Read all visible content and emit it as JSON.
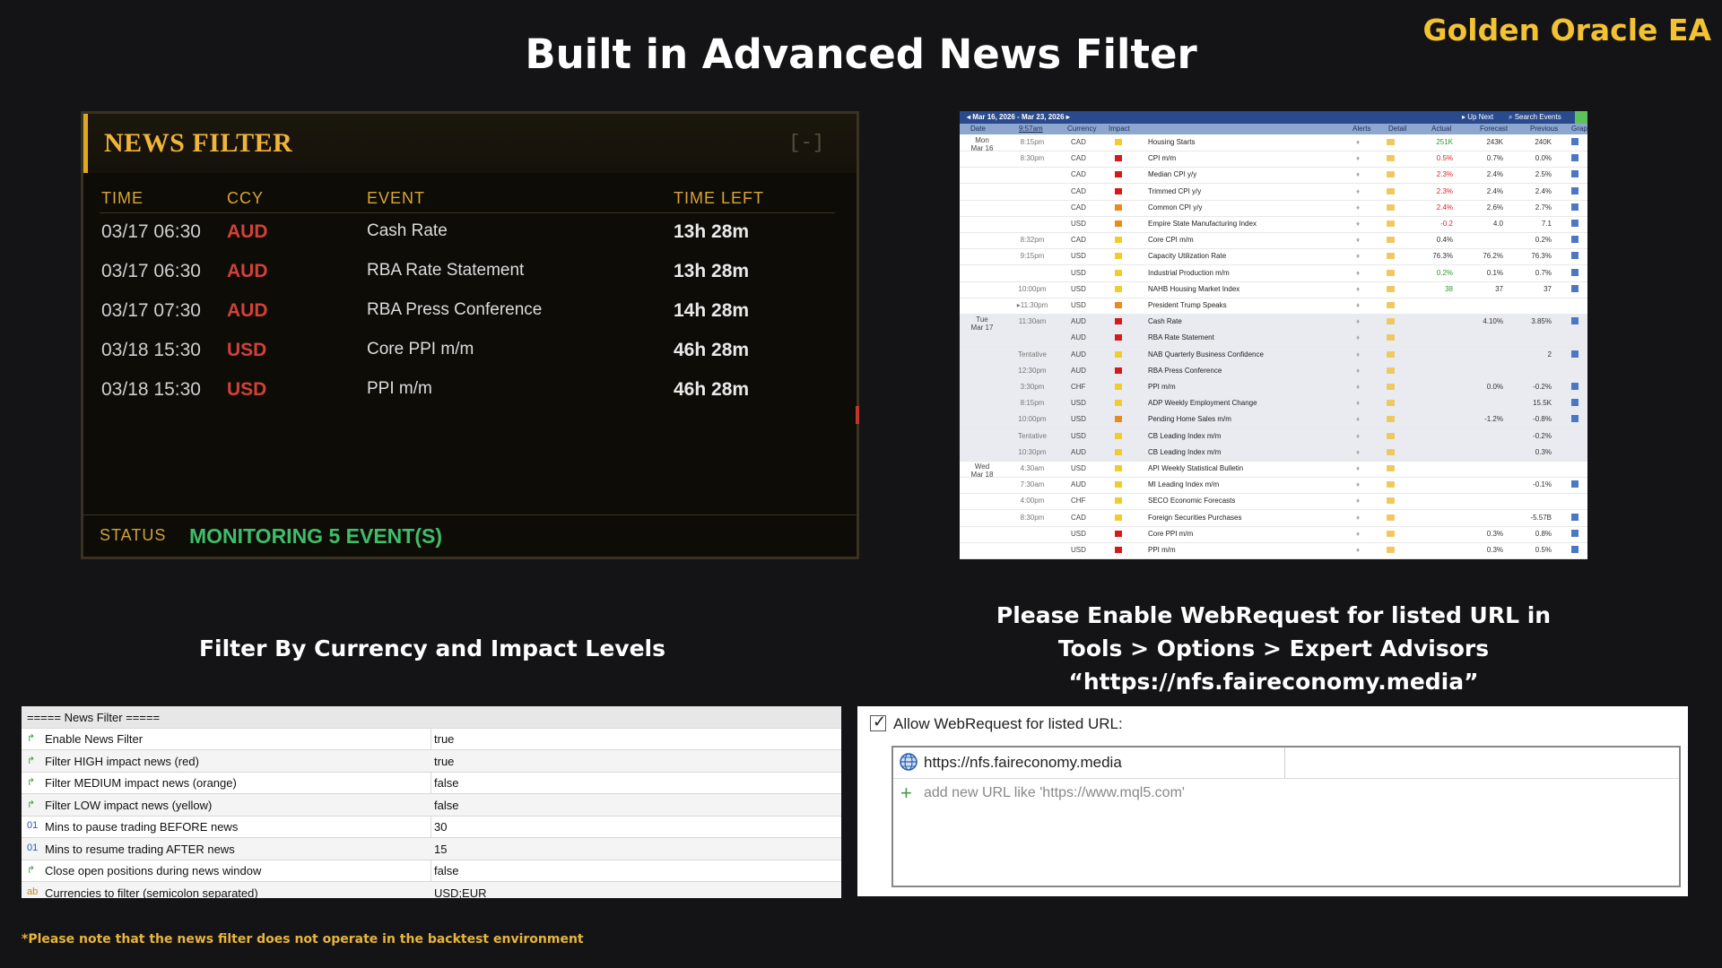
{
  "brand": "Golden Oracle EA",
  "title": "Built in Advanced News Filter",
  "news_filter": {
    "title": "NEWS FILTER",
    "collapse": "[-]",
    "columns": [
      "TIME",
      "CCY",
      "EVENT",
      "TIME LEFT"
    ],
    "rows": [
      {
        "time": "03/17 06:30",
        "ccy": "AUD",
        "event": "Cash Rate",
        "time_left": "13h 28m"
      },
      {
        "time": "03/17 06:30",
        "ccy": "AUD",
        "event": "RBA Rate Statement",
        "time_left": "13h 28m"
      },
      {
        "time": "03/17 07:30",
        "ccy": "AUD",
        "event": "RBA Press Conference",
        "time_left": "14h 28m"
      },
      {
        "time": "03/18 15:30",
        "ccy": "USD",
        "event": "Core PPI m/m",
        "time_left": "46h 28m"
      },
      {
        "time": "03/18 15:30",
        "ccy": "USD",
        "event": "PPI m/m",
        "time_left": "46h 28m"
      }
    ],
    "status_label": "STATUS",
    "status_value": "MONITORING 5 EVENT(S)"
  },
  "calendar": {
    "range": "◂  Mar 16, 2026 - Mar 23, 2026  ▸",
    "up_next": "▸ Up Next",
    "search": "⌕ Search Events",
    "headers": [
      "Date",
      "9:57am",
      "Currency",
      "Impact",
      "Alerts",
      "Detail",
      "Actual",
      "Forecast",
      "Previous",
      "Graph"
    ],
    "days": [
      {
        "label": "Mon\nMar 16",
        "row": 0
      },
      {
        "label": "Tue\nMar 17",
        "row": 11
      },
      {
        "label": "Wed\nMar 18",
        "row": 20
      }
    ],
    "rows": [
      {
        "time": "8:15pm",
        "cur": "CAD",
        "impact": "yellow",
        "event": "Housing Starts",
        "actual": "251K",
        "actual_color": "#2a9a2a",
        "forecast": "243K",
        "previous": "240K",
        "graph": true,
        "detail": true
      },
      {
        "time": "8:30pm",
        "cur": "CAD",
        "impact": "red",
        "event": "CPI m/m",
        "actual": "0.5%",
        "actual_color": "#d22",
        "forecast": "0.7%",
        "previous": "0.0%",
        "graph": true,
        "detail": true
      },
      {
        "time": "",
        "cur": "CAD",
        "impact": "red",
        "event": "Median CPI y/y",
        "actual": "2.3%",
        "actual_color": "#d22",
        "forecast": "2.4%",
        "previous": "2.5%",
        "graph": true,
        "detail": true
      },
      {
        "time": "",
        "cur": "CAD",
        "impact": "red",
        "event": "Trimmed CPI y/y",
        "actual": "2.3%",
        "actual_color": "#d22",
        "forecast": "2.4%",
        "previous": "2.4%",
        "graph": true,
        "detail": true
      },
      {
        "time": "",
        "cur": "CAD",
        "impact": "orange",
        "event": "Common CPI y/y",
        "actual": "2.4%",
        "actual_color": "#d22",
        "forecast": "2.6%",
        "previous": "2.7%",
        "graph": true,
        "detail": true
      },
      {
        "time": "",
        "cur": "USD",
        "impact": "orange",
        "event": "Empire State Manufacturing Index",
        "actual": "-0.2",
        "actual_color": "#d22",
        "forecast": "4.0",
        "previous": "7.1",
        "graph": true,
        "detail": true
      },
      {
        "time": "8:32pm",
        "cur": "CAD",
        "impact": "yellow",
        "event": "Core CPI m/m",
        "actual": "0.4%",
        "actual_color": "#333",
        "forecast": "",
        "previous": "0.2%",
        "graph": true,
        "detail": true
      },
      {
        "time": "9:15pm",
        "cur": "USD",
        "impact": "yellow",
        "event": "Capacity Utilization Rate",
        "actual": "76.3%",
        "actual_color": "#333",
        "forecast": "76.2%",
        "previous": "76.3%",
        "graph": true,
        "detail": true
      },
      {
        "time": "",
        "cur": "USD",
        "impact": "yellow",
        "event": "Industrial Production m/m",
        "actual": "0.2%",
        "actual_color": "#2a9a2a",
        "forecast": "0.1%",
        "previous": "0.7%",
        "graph": true,
        "detail": true
      },
      {
        "time": "10:00pm",
        "cur": "USD",
        "impact": "yellow",
        "event": "NAHB Housing Market Index",
        "actual": "38",
        "actual_color": "#2a9a2a",
        "forecast": "37",
        "previous": "37",
        "graph": true,
        "detail": true
      },
      {
        "time": "▸11:30pm",
        "cur": "USD",
        "impact": "orange",
        "event": "President Trump Speaks",
        "actual": "",
        "actual_color": "#333",
        "forecast": "",
        "previous": "",
        "graph": false,
        "detail": true
      },
      {
        "time": "11:30am",
        "cur": "AUD",
        "impact": "red",
        "event": "Cash Rate",
        "actual": "",
        "actual_color": "#333",
        "forecast": "4.10%",
        "previous": "3.85%",
        "graph": true,
        "detail": true
      },
      {
        "time": "",
        "cur": "AUD",
        "impact": "red",
        "event": "RBA Rate Statement",
        "actual": "",
        "actual_color": "#333",
        "forecast": "",
        "previous": "",
        "graph": false,
        "detail": true
      },
      {
        "time": "Tentative",
        "cur": "AUD",
        "impact": "yellow",
        "event": "NAB Quarterly Business Confidence",
        "actual": "",
        "actual_color": "#333",
        "forecast": "",
        "previous": "2",
        "graph": true,
        "detail": true
      },
      {
        "time": "12:30pm",
        "cur": "AUD",
        "impact": "red",
        "event": "RBA Press Conference",
        "actual": "",
        "actual_color": "#333",
        "forecast": "",
        "previous": "",
        "graph": false,
        "detail": true
      },
      {
        "time": "3:30pm",
        "cur": "CHF",
        "impact": "yellow",
        "event": "PPI m/m",
        "actual": "",
        "actual_color": "#333",
        "forecast": "0.0%",
        "previous": "-0.2%",
        "graph": true,
        "detail": true
      },
      {
        "time": "8:15pm",
        "cur": "USD",
        "impact": "yellow",
        "event": "ADP Weekly Employment Change",
        "actual": "",
        "actual_color": "#333",
        "forecast": "",
        "previous": "15.5K",
        "graph": true,
        "detail": true
      },
      {
        "time": "10:00pm",
        "cur": "USD",
        "impact": "orange",
        "event": "Pending Home Sales m/m",
        "actual": "",
        "actual_color": "#333",
        "forecast": "-1.2%",
        "previous": "-0.8%",
        "graph": true,
        "detail": true
      },
      {
        "time": "Tentative",
        "cur": "USD",
        "impact": "yellow",
        "event": "CB Leading Index m/m",
        "actual": "",
        "actual_color": "#333",
        "forecast": "",
        "previous": "-0.2%",
        "graph": false,
        "detail": true
      },
      {
        "time": "10:30pm",
        "cur": "AUD",
        "impact": "yellow",
        "event": "CB Leading Index m/m",
        "actual": "",
        "actual_color": "#333",
        "forecast": "",
        "previous": "0.3%",
        "graph": false,
        "detail": true
      },
      {
        "time": "4:30am",
        "cur": "USD",
        "impact": "yellow",
        "event": "API Weekly Statistical Bulletin",
        "actual": "",
        "actual_color": "#333",
        "forecast": "",
        "previous": "",
        "graph": false,
        "detail": true
      },
      {
        "time": "7:30am",
        "cur": "AUD",
        "impact": "yellow",
        "event": "MI Leading Index m/m",
        "actual": "",
        "actual_color": "#333",
        "forecast": "",
        "previous": "-0.1%",
        "graph": true,
        "detail": true
      },
      {
        "time": "4:00pm",
        "cur": "CHF",
        "impact": "yellow",
        "event": "SECO Economic Forecasts",
        "actual": "",
        "actual_color": "#333",
        "forecast": "",
        "previous": "",
        "graph": false,
        "detail": true
      },
      {
        "time": "8:30pm",
        "cur": "CAD",
        "impact": "yellow",
        "event": "Foreign Securities Purchases",
        "actual": "",
        "actual_color": "#333",
        "forecast": "",
        "previous": "-5.57B",
        "graph": true,
        "detail": true
      },
      {
        "time": "",
        "cur": "USD",
        "impact": "red",
        "event": "Core PPI m/m",
        "actual": "",
        "actual_color": "#333",
        "forecast": "0.3%",
        "previous": "0.8%",
        "graph": true,
        "detail": true
      },
      {
        "time": "",
        "cur": "USD",
        "impact": "red",
        "event": "PPI m/m",
        "actual": "",
        "actual_color": "#333",
        "forecast": "0.3%",
        "previous": "0.5%",
        "graph": true,
        "detail": true
      }
    ]
  },
  "impact_colors": {
    "red": "#d41a1a",
    "orange": "#e88a1c",
    "yellow": "#f2cc2a"
  },
  "section_left": "Filter By Currency and Impact Levels",
  "section_right": [
    "Please Enable WebRequest for listed URL in",
    "Tools > Options > Expert Advisors",
    "“https://nfs.faireconomy.media”"
  ],
  "params": {
    "header": "===== News Filter =====",
    "rows": [
      {
        "icon": "flag",
        "name": "Enable News Filter",
        "value": "true"
      },
      {
        "icon": "flag",
        "name": "Filter HIGH impact news (red)",
        "value": "true"
      },
      {
        "icon": "flag",
        "name": "Filter MEDIUM impact news (orange)",
        "value": "false"
      },
      {
        "icon": "flag",
        "name": "Filter LOW impact news (yellow)",
        "value": "false"
      },
      {
        "icon": "int",
        "name": "Mins to pause trading BEFORE news",
        "value": "30"
      },
      {
        "icon": "int",
        "name": "Mins to resume trading AFTER news",
        "value": "15"
      },
      {
        "icon": "flag",
        "name": "Close open positions during news window",
        "value": "false"
      },
      {
        "icon": "str",
        "name": "Currencies to filter (semicolon separated)",
        "value": "USD;EUR"
      }
    ]
  },
  "webrequest": {
    "checkbox_label": "Allow WebRequest for listed URL:",
    "checked": true,
    "url": "https://nfs.faireconomy.media",
    "add_placeholder": "add new URL like 'https://www.mql5.com'"
  },
  "note": "*Please note that the news filter does not operate in the backtest environment"
}
